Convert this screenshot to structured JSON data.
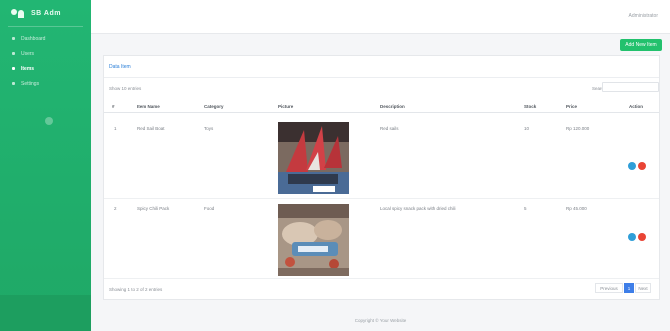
{
  "brand": {
    "name": "SB Adm"
  },
  "nav": {
    "items": [
      {
        "label": "Dashboard"
      },
      {
        "label": "Users"
      },
      {
        "label": "Items"
      },
      {
        "label": "Settings"
      }
    ]
  },
  "topbar": {
    "user": "Administrator"
  },
  "actions": {
    "add_label": "Add New Item"
  },
  "card": {
    "title": "Data Item",
    "show_entries": "Show 10 entries",
    "search_label": "Search:"
  },
  "table": {
    "headers": [
      "#",
      "Item Name",
      "Category",
      "Picture",
      "Description",
      "Stock",
      "Price",
      "Action"
    ],
    "rows": [
      {
        "no": "1",
        "name": "Red Sail Boat",
        "category": "Toys",
        "description": "Red sails",
        "stock": "10",
        "price": "Rp 120.000"
      },
      {
        "no": "2",
        "name": "Spicy Chili Pack",
        "category": "Food",
        "description": "Local spicy snack pack with dried chili",
        "stock": "5",
        "price": "Rp 45.000"
      }
    ]
  },
  "pagination": {
    "info": "Showing 1 to 2 of 2 entries",
    "prev": "Previous",
    "current": "1",
    "next": "Next"
  },
  "footer": {
    "text": "Copyright © Your Website"
  },
  "colors": {
    "sidebar": "#22b673",
    "accent": "#22c16d",
    "edit": "#2f9ed8",
    "delete": "#e94435",
    "page_active": "#3e7ee8"
  }
}
